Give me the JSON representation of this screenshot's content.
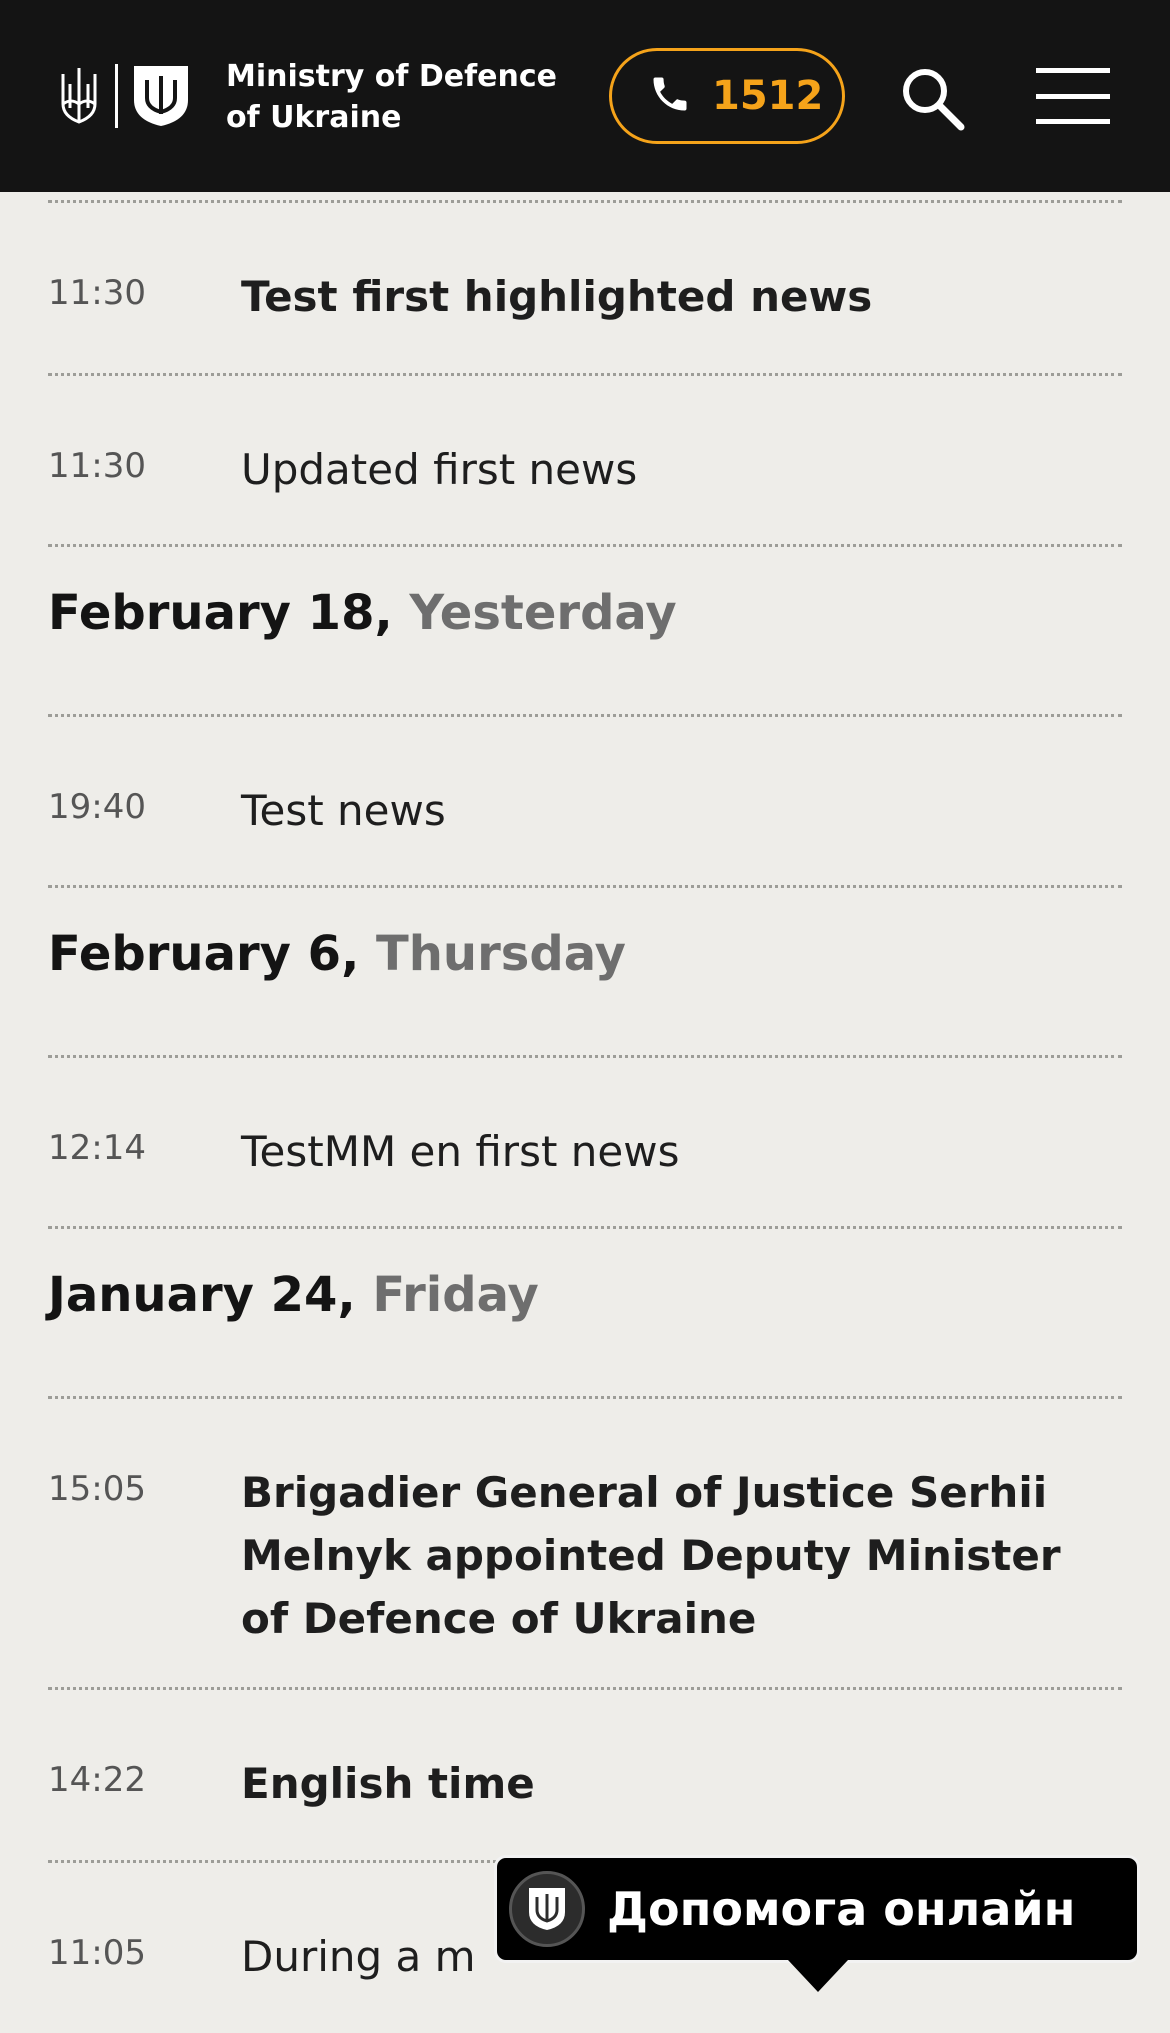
{
  "header": {
    "brand_line1": "Ministry of Defence",
    "brand_line2": "of Ukraine",
    "phone_number": "1512",
    "accent_color": "#f5a31a",
    "background_color": "#141414",
    "icons": [
      "trident-icon",
      "shield-icon",
      "phone-icon",
      "search-icon",
      "hamburger-menu-icon"
    ]
  },
  "news": {
    "group1": {
      "items": [
        {
          "time": "11:30",
          "title": "Test first highlighted news",
          "highlighted": true
        },
        {
          "time": "11:30",
          "title": "Updated first news",
          "highlighted": false
        }
      ]
    },
    "group2": {
      "date": "February 18,",
      "day": "Yesterday",
      "items": [
        {
          "time": "19:40",
          "title": "Test news",
          "highlighted": false
        }
      ]
    },
    "group3": {
      "date": "February 6,",
      "day": "Thursday",
      "items": [
        {
          "time": "12:14",
          "title": "TestMM en first news",
          "highlighted": false
        }
      ]
    },
    "group4": {
      "date": "January 24,",
      "day": "Friday",
      "items": [
        {
          "time": "15:05",
          "title": "Brigadier General of Justice Serhii Melnyk appointed Deputy Minister of Defence of Ukraine",
          "highlighted": true
        },
        {
          "time": "14:22",
          "title": "English time",
          "highlighted": true
        },
        {
          "time": "11:05",
          "title": "During a m",
          "highlighted": false
        }
      ]
    }
  },
  "help_widget": {
    "label": "Допомога онлайн",
    "icon": "shield-icon"
  }
}
